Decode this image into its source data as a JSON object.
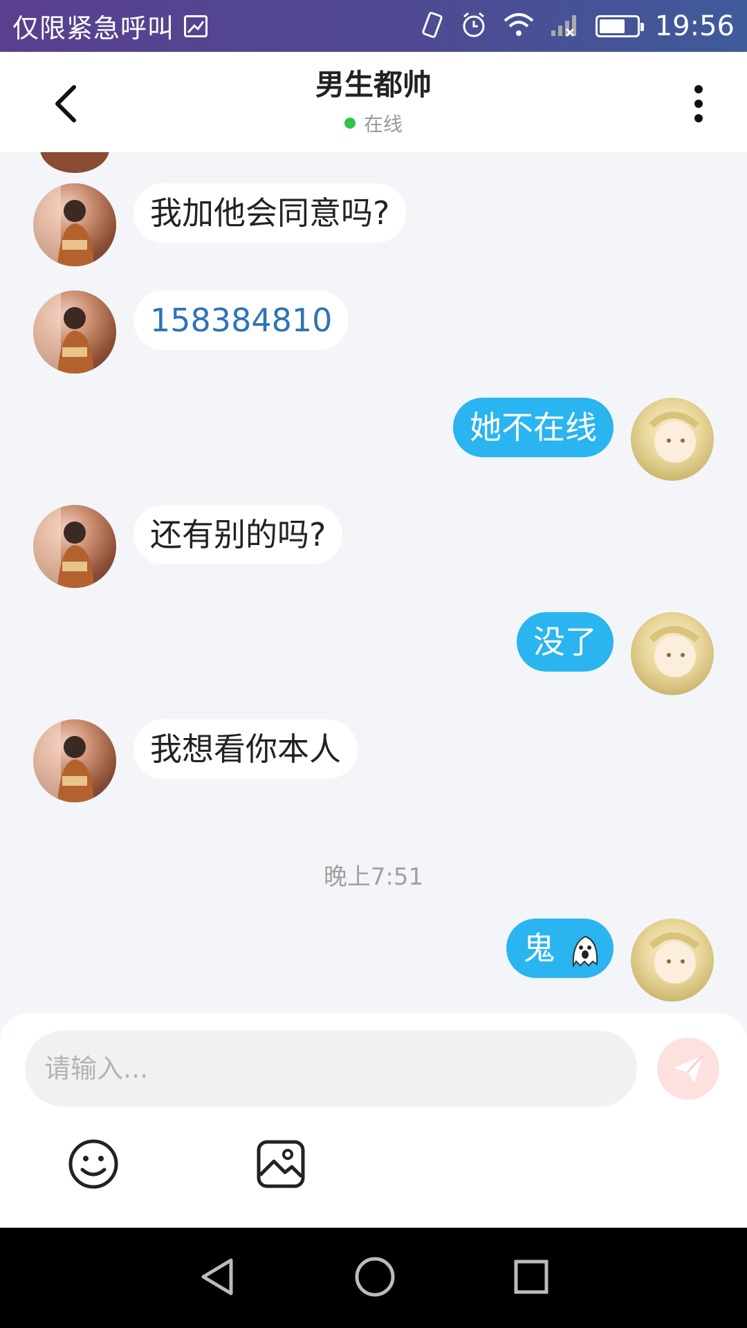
{
  "status_bar": {
    "carrier": "仅限紧急呼叫",
    "time": "19:56",
    "battery_level": 0.7
  },
  "header": {
    "title": "男生都帅",
    "status": "在线"
  },
  "messages": [
    {
      "side": "in",
      "text": "我加他会同意吗?"
    },
    {
      "side": "in",
      "text": "158384810"
    },
    {
      "side": "out",
      "text": "她不在线"
    },
    {
      "side": "in",
      "text": "还有别的吗?"
    },
    {
      "side": "out",
      "text": "没了"
    },
    {
      "side": "in",
      "text": "我想看你本人"
    },
    {
      "side": "out",
      "text": "鬼"
    }
  ],
  "timestamp": "晚上7:51",
  "composer": {
    "placeholder": "请输入..."
  },
  "icons": {
    "back": "chevron-left-icon",
    "more": "more-vertical-icon",
    "send": "send-icon",
    "emoji": "emoji-icon",
    "image": "image-icon",
    "ghost": "ghost-emoji"
  },
  "colors": {
    "outgoing_bubble": "#2ab4f0",
    "incoming_bubble": "#ffffff",
    "online": "#2fc54b",
    "link": "#2e73b8"
  }
}
